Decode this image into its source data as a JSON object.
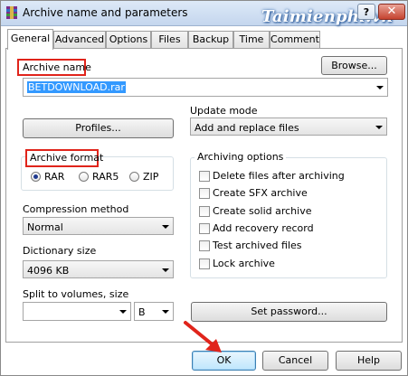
{
  "window": {
    "title": "Archive name and parameters",
    "watermark": "Taimienphi.vn",
    "help_label": "?",
    "close_label": "✕"
  },
  "tabs": [
    {
      "label": "General",
      "active": true
    },
    {
      "label": "Advanced"
    },
    {
      "label": "Options"
    },
    {
      "label": "Files"
    },
    {
      "label": "Backup"
    },
    {
      "label": "Time"
    },
    {
      "label": "Comment"
    }
  ],
  "archive_name": {
    "label": "Archive name",
    "value": "BETDOWNLOAD.rar",
    "browse_label": "Browse..."
  },
  "profiles_label": "Profiles...",
  "update_mode": {
    "label": "Update mode",
    "value": "Add and replace files"
  },
  "archive_format": {
    "label": "Archive format",
    "options": [
      {
        "label": "RAR",
        "checked": true
      },
      {
        "label": "RAR5",
        "checked": false
      },
      {
        "label": "ZIP",
        "checked": false
      }
    ]
  },
  "archiving_options": {
    "label": "Archiving options",
    "items": [
      {
        "label": "Delete files after archiving",
        "checked": false
      },
      {
        "label": "Create SFX archive",
        "checked": false
      },
      {
        "label": "Create solid archive",
        "checked": false
      },
      {
        "label": "Add recovery record",
        "checked": false
      },
      {
        "label": "Test archived files",
        "checked": false
      },
      {
        "label": "Lock archive",
        "checked": false
      }
    ]
  },
  "compression": {
    "label": "Compression method",
    "value": "Normal"
  },
  "dictionary": {
    "label": "Dictionary size",
    "value": "4096 KB"
  },
  "split": {
    "label": "Split to volumes, size",
    "value": "",
    "unit": "B"
  },
  "set_password_label": "Set password...",
  "footer": {
    "ok_label": "OK",
    "cancel_label": "Cancel",
    "help_label": "Help"
  },
  "colors": {
    "highlight_box": "#e0241b",
    "selection": "#3399ff",
    "annotation_arrow": "#e0241b"
  }
}
